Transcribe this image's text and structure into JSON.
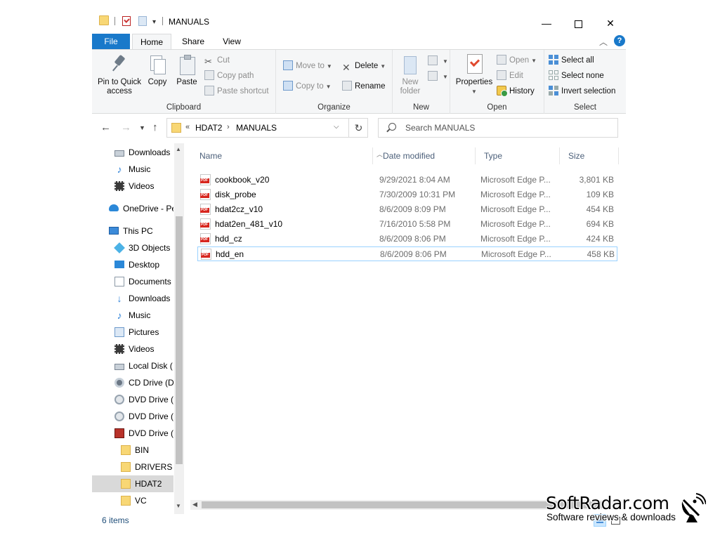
{
  "window": {
    "title": "MANUALS",
    "controls": {
      "minimize": "—",
      "maximize": "☐",
      "close": "✕"
    }
  },
  "tabs": [
    {
      "label": "File"
    },
    {
      "label": "Home"
    },
    {
      "label": "Share"
    },
    {
      "label": "View"
    }
  ],
  "ribbon": {
    "clipboard": {
      "label": "Clipboard",
      "pin": "Pin to Quick access",
      "pin_line1": "Pin to Quick",
      "pin_line2": "access",
      "copy": "Copy",
      "paste": "Paste",
      "cut": "Cut",
      "copy_path": "Copy path",
      "paste_shortcut": "Paste shortcut"
    },
    "organize": {
      "label": "Organize",
      "move_to": "Move to",
      "copy_to": "Copy to",
      "delete": "Delete",
      "rename": "Rename"
    },
    "new": {
      "label": "New",
      "new_folder_line1": "New",
      "new_folder_line2": "folder"
    },
    "open": {
      "label": "Open",
      "properties": "Properties",
      "open": "Open",
      "edit": "Edit",
      "history": "History"
    },
    "select": {
      "label": "Select",
      "select_all": "Select all",
      "select_none": "Select none",
      "invert": "Invert selection"
    }
  },
  "address": {
    "overflow": "«",
    "parts": [
      "HDAT2",
      "MANUALS"
    ],
    "separator": "›"
  },
  "search": {
    "placeholder": "Search MANUALS"
  },
  "nav": {
    "items": [
      {
        "label": "Downloads",
        "icon": "downloads-drive-icon"
      },
      {
        "label": "Music",
        "icon": "music-icon"
      },
      {
        "label": "Videos",
        "icon": "videos-icon"
      },
      {
        "label": "OneDrive - Pe",
        "icon": "onedrive-icon"
      },
      {
        "label": "This PC",
        "icon": "this-pc-icon"
      },
      {
        "label": "3D Objects",
        "icon": "3d-objects-icon"
      },
      {
        "label": "Desktop",
        "icon": "desktop-icon"
      },
      {
        "label": "Documents",
        "icon": "documents-icon"
      },
      {
        "label": "Downloads",
        "icon": "downloads-icon"
      },
      {
        "label": "Music",
        "icon": "music-icon"
      },
      {
        "label": "Pictures",
        "icon": "pictures-icon"
      },
      {
        "label": "Videos",
        "icon": "videos-icon"
      },
      {
        "label": "Local Disk (",
        "icon": "local-disk-icon"
      },
      {
        "label": "CD Drive (D:",
        "icon": "cd-drive-icon"
      },
      {
        "label": "DVD Drive (I",
        "icon": "dvd-drive-icon"
      },
      {
        "label": "DVD Drive (I",
        "icon": "dvd-drive-icon"
      },
      {
        "label": "DVD Drive (",
        "icon": "dvd-game-drive-icon"
      },
      {
        "label": "BIN",
        "icon": "folder-icon"
      },
      {
        "label": "DRIVERS",
        "icon": "folder-icon"
      },
      {
        "label": "HDAT2",
        "icon": "folder-icon"
      },
      {
        "label": "VC",
        "icon": "folder-icon"
      }
    ]
  },
  "columns": {
    "name": "Name",
    "date": "Date modified",
    "type": "Type",
    "size": "Size"
  },
  "files": [
    {
      "name": "cookbook_v20",
      "date": "9/29/2021 8:04 AM",
      "type": "Microsoft Edge P...",
      "size": "3,801 KB"
    },
    {
      "name": "disk_probe",
      "date": "7/30/2009 10:31 PM",
      "type": "Microsoft Edge P...",
      "size": "109 KB"
    },
    {
      "name": "hdat2cz_v10",
      "date": "8/6/2009 8:09 PM",
      "type": "Microsoft Edge P...",
      "size": "454 KB"
    },
    {
      "name": "hdat2en_481_v10",
      "date": "7/16/2010 5:58 PM",
      "type": "Microsoft Edge P...",
      "size": "694 KB"
    },
    {
      "name": "hdd_cz",
      "date": "8/6/2009 8:06 PM",
      "type": "Microsoft Edge P...",
      "size": "424 KB"
    },
    {
      "name": "hdd_en",
      "date": "8/6/2009 8:06 PM",
      "type": "Microsoft Edge P...",
      "size": "458 KB"
    }
  ],
  "status": {
    "count": "6 items"
  },
  "watermark": {
    "title": "SoftRadar.com",
    "subtitle": "Software reviews & downloads"
  },
  "colors": {
    "accent": "#1979ca",
    "ribbon_bg": "#f5f6f7",
    "selection": "#cce8ff",
    "focus_border": "#99d1ff"
  }
}
